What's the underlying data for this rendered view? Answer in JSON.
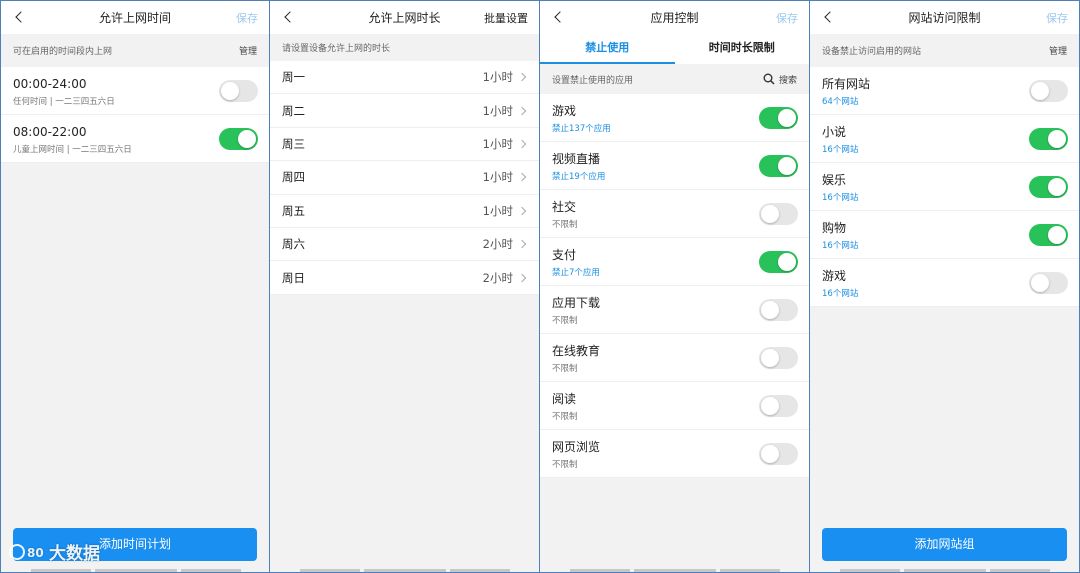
{
  "panel1": {
    "title": "允许上网时间",
    "save": "保存",
    "subtitle": "可在启用的时间段内上网",
    "manage": "管理",
    "items": [
      {
        "title": "00:00-24:00",
        "sub": "任何时间 | 一二三四五六日",
        "enabled": false
      },
      {
        "title": "08:00-22:00",
        "sub": "儿童上网时间 | 一二三四五六日",
        "enabled": true
      }
    ],
    "button": "添加时间计划",
    "watermark": "大数据"
  },
  "panel2": {
    "title": "允许上网时长",
    "action": "批量设置",
    "subtitle": "请设置设备允许上网的时长",
    "days": [
      {
        "day": "周一",
        "value": "1小时"
      },
      {
        "day": "周二",
        "value": "1小时"
      },
      {
        "day": "周三",
        "value": "1小时"
      },
      {
        "day": "周四",
        "value": "1小时"
      },
      {
        "day": "周五",
        "value": "1小时"
      },
      {
        "day": "周六",
        "value": "2小时"
      },
      {
        "day": "周日",
        "value": "2小时"
      }
    ]
  },
  "panel3": {
    "title": "应用控制",
    "save": "保存",
    "tabs": [
      "禁止使用",
      "时间时长限制"
    ],
    "subtitle": "设置禁止使用的应用",
    "search": "搜索",
    "items": [
      {
        "title": "游戏",
        "sub": "禁止137个应用",
        "enabled": true
      },
      {
        "title": "视频直播",
        "sub": "禁止19个应用",
        "enabled": true
      },
      {
        "title": "社交",
        "sub": "不限制",
        "enabled": false
      },
      {
        "title": "支付",
        "sub": "禁止7个应用",
        "enabled": true
      },
      {
        "title": "应用下载",
        "sub": "不限制",
        "enabled": false
      },
      {
        "title": "在线教育",
        "sub": "不限制",
        "enabled": false
      },
      {
        "title": "阅读",
        "sub": "不限制",
        "enabled": false
      },
      {
        "title": "网页浏览",
        "sub": "不限制",
        "enabled": false
      }
    ]
  },
  "panel4": {
    "title": "网站访问限制",
    "save": "保存",
    "subtitle": "设备禁止访问启用的网站",
    "manage": "管理",
    "items": [
      {
        "title": "所有网站",
        "sub": "64个网站",
        "enabled": false
      },
      {
        "title": "小说",
        "sub": "16个网站",
        "enabled": true
      },
      {
        "title": "娱乐",
        "sub": "16个网站",
        "enabled": true
      },
      {
        "title": "购物",
        "sub": "16个网站",
        "enabled": true
      },
      {
        "title": "游戏",
        "sub": "16个网站",
        "enabled": false
      }
    ],
    "button": "添加网站组"
  },
  "colors": {
    "accent": "#1a8fe3",
    "toggle_on": "#29c25a",
    "toggle_off": "#e6e6e6",
    "save_disabled": "#9cc9ee"
  }
}
